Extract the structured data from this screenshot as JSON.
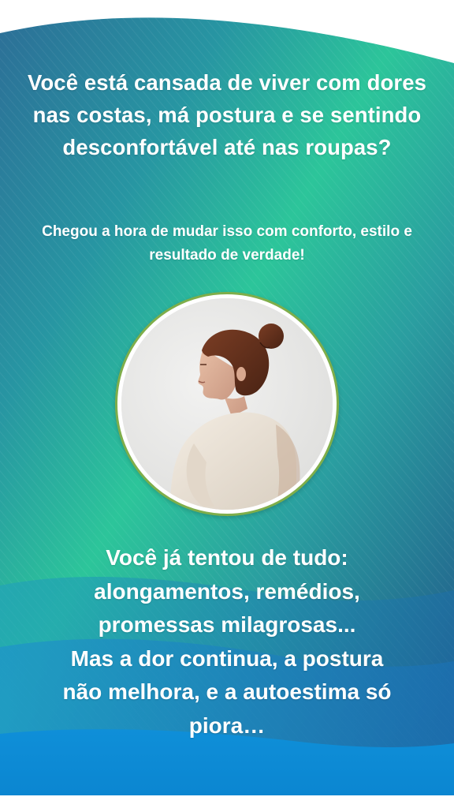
{
  "hero": {
    "headline": "Você está cansada de viver com dores nas costas, má postura e se sentindo desconfortável até nas roupas?",
    "subline": "Chegou a hora de mudar isso com conforto, estilo e resultado de verdade!"
  },
  "image": {
    "description_icon": "woman-profile-posture-photo"
  },
  "problem": {
    "line1": "Você já tentou de tudo:",
    "line2": "alongamentos, remédios,",
    "line3": "promessas milagrosas...",
    "line4": "Mas a dor continua, a postura",
    "line5": "não melhora, e a autoestima só",
    "line6": "piora…"
  },
  "colors": {
    "gradient_teal": "#2ec79a",
    "gradient_deep": "#1f5f8f",
    "wave_blue": "#0c8fd6",
    "ring_green": "#7fae4a"
  }
}
